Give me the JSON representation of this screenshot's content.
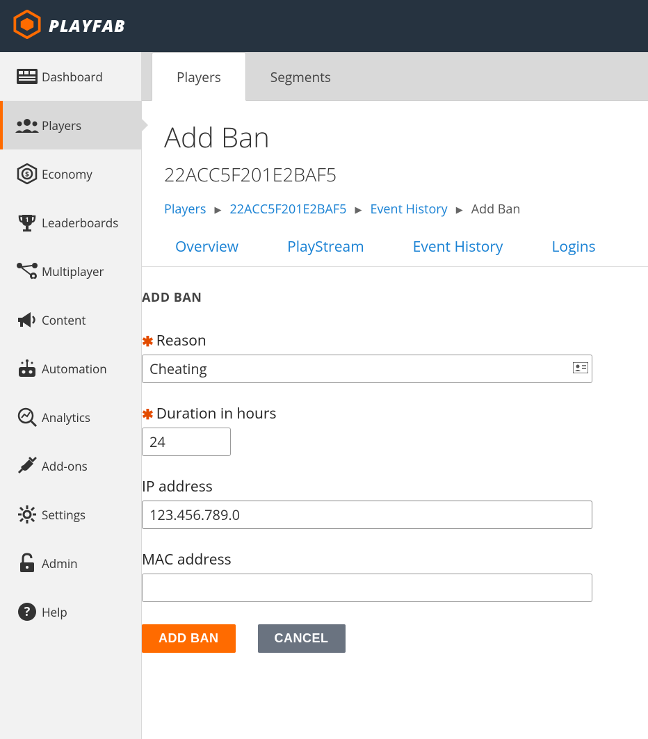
{
  "brand": {
    "name": "PLAYFAB"
  },
  "sidebar": {
    "items": [
      {
        "id": "dashboard",
        "label": "Dashboard"
      },
      {
        "id": "players",
        "label": "Players"
      },
      {
        "id": "economy",
        "label": "Economy"
      },
      {
        "id": "leaderboards",
        "label": "Leaderboards"
      },
      {
        "id": "multiplayer",
        "label": "Multiplayer"
      },
      {
        "id": "content",
        "label": "Content"
      },
      {
        "id": "automation",
        "label": "Automation"
      },
      {
        "id": "analytics",
        "label": "Analytics"
      },
      {
        "id": "addons",
        "label": "Add-ons"
      },
      {
        "id": "settings",
        "label": "Settings"
      },
      {
        "id": "admin",
        "label": "Admin"
      },
      {
        "id": "help",
        "label": "Help"
      }
    ]
  },
  "top_tabs": {
    "players": "Players",
    "segments": "Segments"
  },
  "page": {
    "title": "Add Ban",
    "subtitle": "22ACC5F201E2BAF5"
  },
  "breadcrumb": {
    "players": "Players",
    "player_id": "22ACC5F201E2BAF5",
    "event_history": "Event History",
    "current": "Add Ban"
  },
  "sub_tabs": {
    "overview": "Overview",
    "playstream": "PlayStream",
    "event_history": "Event History",
    "logins": "Logins"
  },
  "form": {
    "heading": "ADD BAN",
    "reason_label": "Reason",
    "reason_value": "Cheating",
    "duration_label": "Duration in hours",
    "duration_value": "24",
    "ip_label": "IP address",
    "ip_value": "123.456.789.0",
    "mac_label": "MAC address",
    "mac_value": "",
    "add_button": "ADD BAN",
    "cancel_button": "CANCEL"
  }
}
